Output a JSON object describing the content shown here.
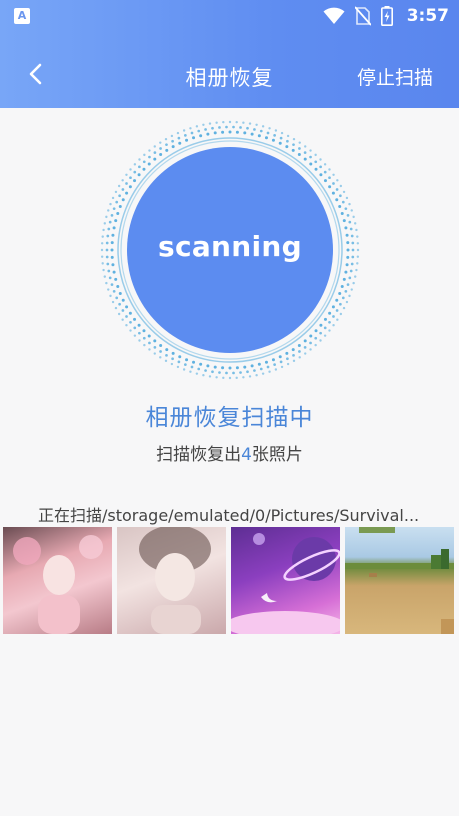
{
  "status_bar": {
    "left_icon": "A",
    "time": "3:57",
    "icons": [
      "wifi-icon",
      "no-sim-icon",
      "battery-charging-icon"
    ]
  },
  "toolbar": {
    "back_icon": "chevron-left-icon",
    "title": "相册恢复",
    "stop_label": "停止扫描"
  },
  "scanner": {
    "label": "scanning",
    "colors": {
      "core": "#5c8cf0",
      "ring": "#4ea9dd"
    }
  },
  "status": {
    "title": "相册恢复扫描中",
    "count_prefix": "扫描恢复出",
    "count": "4",
    "count_suffix": "张照片"
  },
  "scan_path": "正在扫描/storage/emulated/0/Pictures/Survival...",
  "thumbnails": [
    {
      "name": "thumb-pink-girl"
    },
    {
      "name": "thumb-girl-portrait"
    },
    {
      "name": "thumb-purple-planet"
    },
    {
      "name": "thumb-blocky-landscape"
    }
  ]
}
